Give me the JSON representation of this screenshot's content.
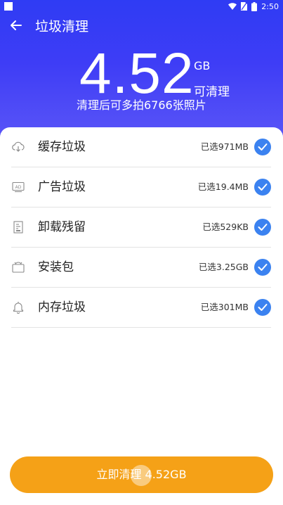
{
  "status_bar": {
    "time": "2:50"
  },
  "app_bar": {
    "title": "垃圾清理",
    "back_icon": "arrow-left-icon"
  },
  "summary": {
    "size_value": "4.52",
    "size_unit": "GB",
    "cleanable_label": "可清理",
    "subtitle": "清理后可多拍6766张照片"
  },
  "items": [
    {
      "icon": "cloud-download-icon",
      "label": "缓存垃圾",
      "value": "已选971MB",
      "checked": true
    },
    {
      "icon": "ad-icon",
      "label": "广告垃圾",
      "value": "已选19.4MB",
      "checked": true
    },
    {
      "icon": "uninstall-residue-icon",
      "label": "卸载残留",
      "value": "已选529KB",
      "checked": true
    },
    {
      "icon": "package-icon",
      "label": "安装包",
      "value": "已选3.25GB",
      "checked": true
    },
    {
      "icon": "memory-icon",
      "label": "内存垃圾",
      "value": "已选301MB",
      "checked": true
    }
  ],
  "action": {
    "button_label": "立即清理 4.52GB"
  },
  "colors": {
    "header": "#3a3cf5",
    "check": "#3b82f0",
    "button": "#f5a117"
  }
}
